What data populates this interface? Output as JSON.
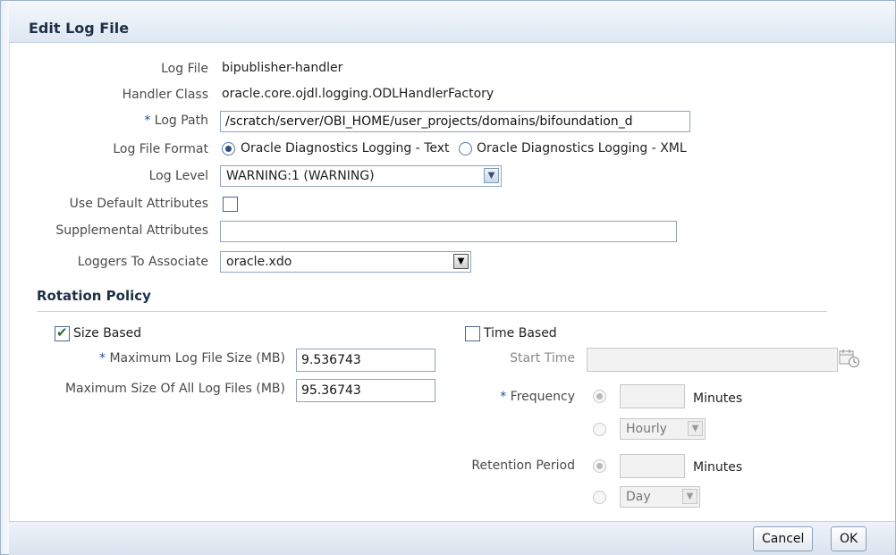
{
  "dialog": {
    "title": "Edit Log File"
  },
  "form": {
    "log_file": {
      "label": "Log File",
      "value": "bipublisher-handler"
    },
    "handler_class": {
      "label": "Handler Class",
      "value": "oracle.core.ojdl.logging.ODLHandlerFactory"
    },
    "log_path": {
      "required_mark": "*",
      "label": "Log Path",
      "value": "/scratch/server/OBI_HOME/user_projects/domains/bifoundation_d"
    },
    "log_file_format": {
      "label": "Log File Format",
      "options": [
        "Oracle Diagnostics Logging - Text",
        "Oracle Diagnostics Logging - XML"
      ],
      "selected": "Oracle Diagnostics Logging - Text"
    },
    "log_level": {
      "label": "Log Level",
      "value": "WARNING:1 (WARNING)"
    },
    "use_default_attributes": {
      "label": "Use Default Attributes",
      "checked": false
    },
    "supplemental_attributes": {
      "label": "Supplemental Attributes",
      "value": ""
    },
    "loggers_to_associate": {
      "label": "Loggers To Associate",
      "value": "oracle.xdo"
    }
  },
  "rotation_policy": {
    "title": "Rotation Policy",
    "size_based": {
      "label": "Size Based",
      "checked": true,
      "max_log_file_size": {
        "required_mark": "*",
        "label": "Maximum Log File Size (MB)",
        "value": "9.536743"
      },
      "max_size_all_files": {
        "label": "Maximum Size Of All Log Files (MB)",
        "value": "95.36743"
      }
    },
    "time_based": {
      "label": "Time Based",
      "checked": false,
      "start_time": {
        "label": "Start Time",
        "value": ""
      },
      "frequency": {
        "required_mark": "*",
        "label": "Frequency",
        "minutes_value": "",
        "minutes_unit": "Minutes",
        "interval": "Hourly"
      },
      "retention_period": {
        "label": "Retention Period",
        "minutes_value": "",
        "minutes_unit": "Minutes",
        "interval": "Day"
      }
    }
  },
  "footer": {
    "cancel_label": "Cancel",
    "ok_label": "OK"
  },
  "icons": {
    "calendar": "calendar-clock-icon",
    "dropdown": "chevron-down-icon"
  }
}
